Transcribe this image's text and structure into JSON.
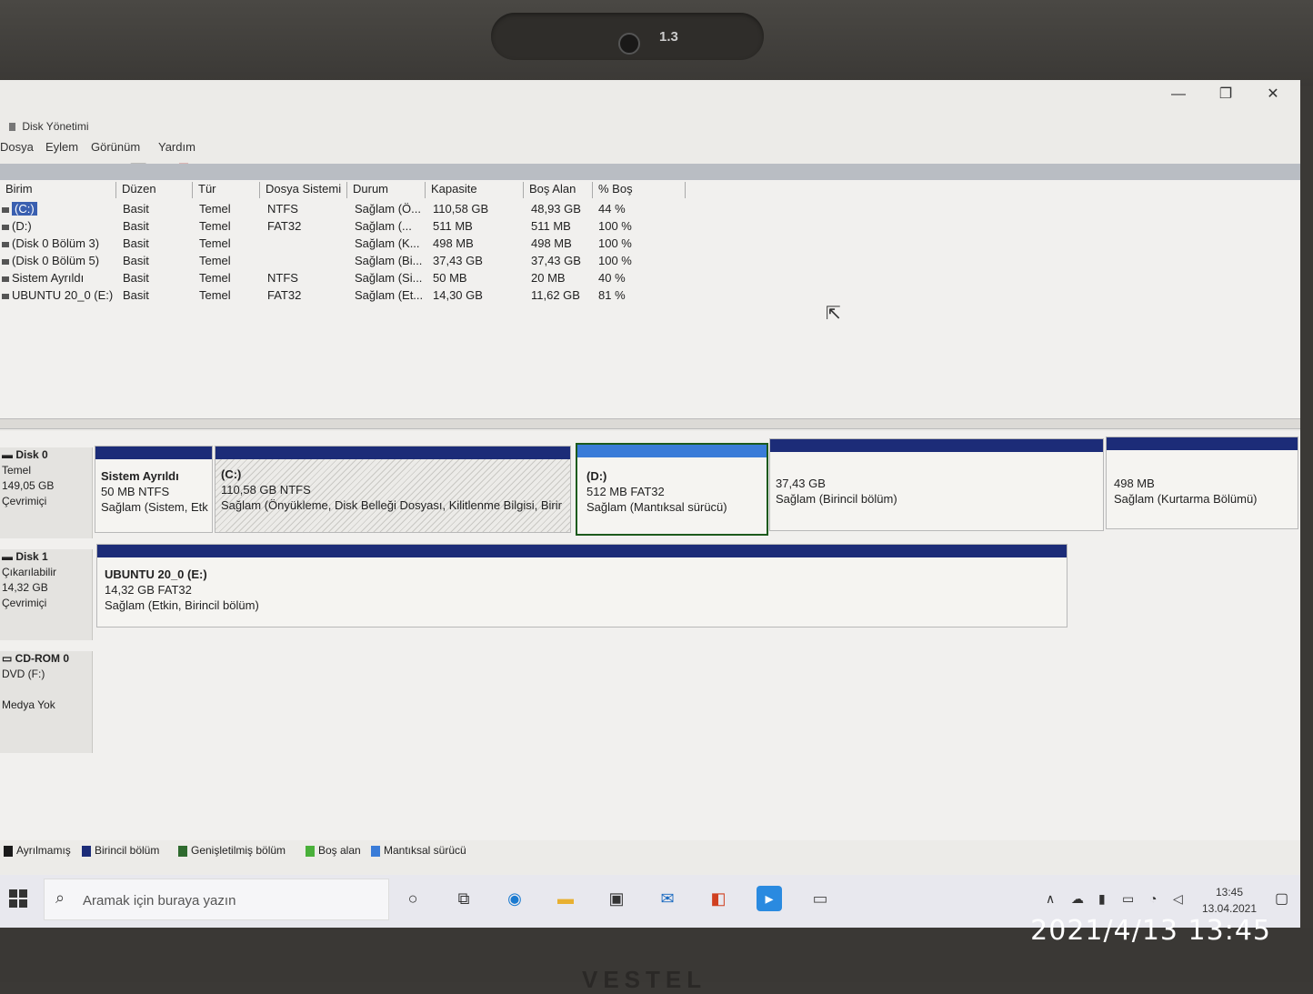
{
  "webcam": {
    "label": "1.3"
  },
  "brand": "VESTEL",
  "photo_stamp": "2021/4/13 13:45",
  "window": {
    "title": "Disk Yönetimi",
    "minimize": "—",
    "maximize": "❐",
    "close": "✕"
  },
  "menu": [
    "Dosya",
    "Eylem",
    "Görünüm",
    "Yardım"
  ],
  "toolbar_icons": [
    "back-arrow-icon",
    "forward-arrow-icon",
    "console-tree-icon",
    "help-icon",
    "properties-icon",
    "connect-icon",
    "delete-icon",
    "check-icon",
    "export-icon",
    "rescan-icon",
    "settings-icon"
  ],
  "columns": [
    "Birim",
    "Düzen",
    "Tür",
    "Dosya Sistemi",
    "Durum",
    "Kapasite",
    "Boş Alan",
    "% Boş"
  ],
  "rows": [
    {
      "volume": "(C:)",
      "layout": "Basit",
      "type": "Temel",
      "fs": "NTFS",
      "status": "Sağlam (Ö...",
      "capacity": "110,58 GB",
      "free": "48,93 GB",
      "pct": "44 %"
    },
    {
      "volume": "(D:)",
      "layout": "Basit",
      "type": "Temel",
      "fs": "FAT32",
      "status": "Sağlam (...",
      "capacity": "511 MB",
      "free": "511 MB",
      "pct": "100 %"
    },
    {
      "volume": "(Disk 0 Bölüm 3)",
      "layout": "Basit",
      "type": "Temel",
      "fs": "",
      "status": "Sağlam (K...",
      "capacity": "498 MB",
      "free": "498 MB",
      "pct": "100 %"
    },
    {
      "volume": "(Disk 0 Bölüm 5)",
      "layout": "Basit",
      "type": "Temel",
      "fs": "",
      "status": "Sağlam (Bi...",
      "capacity": "37,43 GB",
      "free": "37,43 GB",
      "pct": "100 %"
    },
    {
      "volume": "Sistem Ayrıldı",
      "layout": "Basit",
      "type": "Temel",
      "fs": "NTFS",
      "status": "Sağlam (Si...",
      "capacity": "50 MB",
      "free": "20 MB",
      "pct": "40 %"
    },
    {
      "volume": "UBUNTU 20_0 (E:)",
      "layout": "Basit",
      "type": "Temel",
      "fs": "FAT32",
      "status": "Sağlam (Et...",
      "capacity": "14,30 GB",
      "free": "11,62 GB",
      "pct": "81 %"
    }
  ],
  "disks": [
    {
      "name": "Disk 0",
      "kind": "Temel",
      "size": "149,05 GB",
      "state": "Çevrimiçi",
      "partitions": [
        {
          "name": "Sistem Ayrıldı",
          "size": "50 MB NTFS",
          "status": "Sağlam (Sistem, Etk"
        },
        {
          "name": "(C:)",
          "size": "110,58 GB NTFS",
          "status": "Sağlam (Önyükleme, Disk Belleği Dosyası, Kilitlenme Bilgisi, Birir"
        },
        {
          "name": "(D:)",
          "size": "512 MB FAT32",
          "status": "Sağlam (Mantıksal sürücü)"
        },
        {
          "name": "",
          "size": "37,43 GB",
          "status": "Sağlam (Birincil bölüm)"
        },
        {
          "name": "",
          "size": "498 MB",
          "status": "Sağlam (Kurtarma Bölümü)"
        }
      ]
    },
    {
      "name": "Disk 1",
      "kind": "Çıkarılabilir",
      "size": "14,32 GB",
      "state": "Çevrimiçi",
      "partitions": [
        {
          "name": "UBUNTU 20_0  (E:)",
          "size": "14,32 GB FAT32",
          "status": "Sağlam (Etkin, Birincil bölüm)"
        }
      ]
    },
    {
      "name": "CD-ROM 0",
      "kind": "DVD (F:)",
      "size": "",
      "state": "Medya Yok"
    }
  ],
  "legend": [
    {
      "label": "Ayrılmamış",
      "color": "#1a1a1a"
    },
    {
      "label": "Birincil bölüm",
      "color": "#1c2c78"
    },
    {
      "label": "Genişletilmiş bölüm",
      "color": "#2e6a2e"
    },
    {
      "label": "Boş alan",
      "color": "#49b03a"
    },
    {
      "label": "Mantıksal sürücü",
      "color": "#3a7cd8"
    }
  ],
  "taskbar": {
    "search_placeholder": "Aramak için buraya yazın",
    "apps": [
      "cortana-icon",
      "task-view-icon",
      "edge-icon",
      "file-explorer-icon",
      "store-icon",
      "mail-icon",
      "office-icon",
      "zoom-icon",
      "disk-management-icon"
    ],
    "tray": [
      "chevron-up-icon",
      "onedrive-icon",
      "microphone-icon",
      "battery-icon",
      "wifi-icon",
      "volume-icon"
    ],
    "time": "13:45",
    "date": "13.04.2021"
  }
}
